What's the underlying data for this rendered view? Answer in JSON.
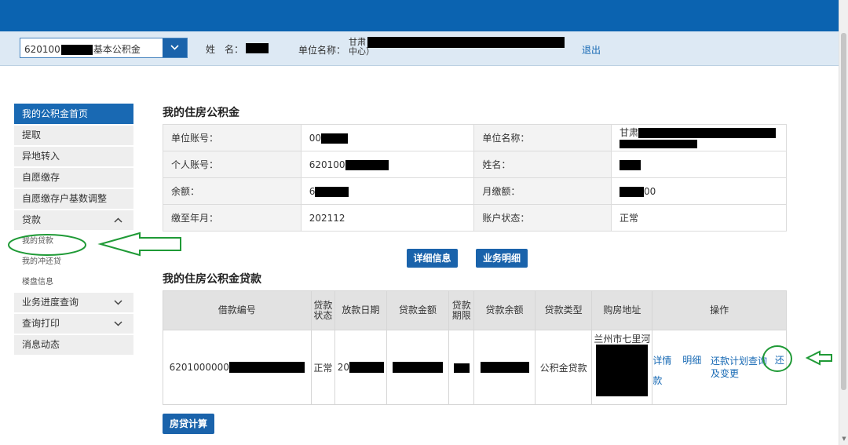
{
  "header": {
    "account_select": {
      "prefix": "620100",
      "suffix": "基本公积金"
    },
    "name_label": "姓　名：",
    "unit_label": "单位名称：",
    "unit_value_line1": "甘肃",
    "unit_value_line2": "中心）",
    "logout": "退出"
  },
  "sidebar": {
    "items": [
      {
        "label": "我的公积金首页"
      },
      {
        "label": "提取"
      },
      {
        "label": "异地转入"
      },
      {
        "label": "自愿缴存"
      },
      {
        "label": "自愿缴存户基数调整"
      },
      {
        "label": "贷款",
        "icon": "chevron-up"
      }
    ],
    "sub_items": [
      {
        "label": "我的贷款"
      },
      {
        "label": "我的冲还贷"
      },
      {
        "label": "楼盘信息"
      }
    ],
    "more_items": [
      {
        "label": "业务进度查询",
        "icon": "chevron-down"
      },
      {
        "label": "查询打印",
        "icon": "chevron-down"
      },
      {
        "label": "消息动态"
      }
    ]
  },
  "fund": {
    "title": "我的住房公积金",
    "rows": [
      {
        "l1": "单位账号：",
        "v1": "00",
        "l2": "单位名称：",
        "v2": "甘肃"
      },
      {
        "l1": "个人账号：",
        "v1": "620100",
        "l2": "姓名：",
        "v2": ""
      },
      {
        "l1": "余额：",
        "v1": "6",
        "l2": "月缴额：",
        "v2": "00"
      },
      {
        "l1": "缴至年月：",
        "v1": "202112",
        "l2": "账户状态：",
        "v2": "正常"
      }
    ],
    "btn_detail": "详细信息",
    "btn_business": "业务明细"
  },
  "loan": {
    "title": "我的住房公积金贷款",
    "headers": [
      "借款编号",
      "贷款状态",
      "放款日期",
      "贷款金额",
      "贷款期限",
      "贷款余额",
      "贷款类型",
      "购房地址",
      "操作"
    ],
    "row": {
      "id": "6201000000",
      "status": "正常",
      "date": "20",
      "type": "公积金贷款",
      "address": "兰州市七里河"
    },
    "ops": {
      "detail": "详情",
      "breakdown": "明细",
      "plan": "还款计划查询及变更",
      "repay": "还款"
    }
  },
  "calc_button": "房贷计算",
  "annotation_color": "#1f9a36"
}
